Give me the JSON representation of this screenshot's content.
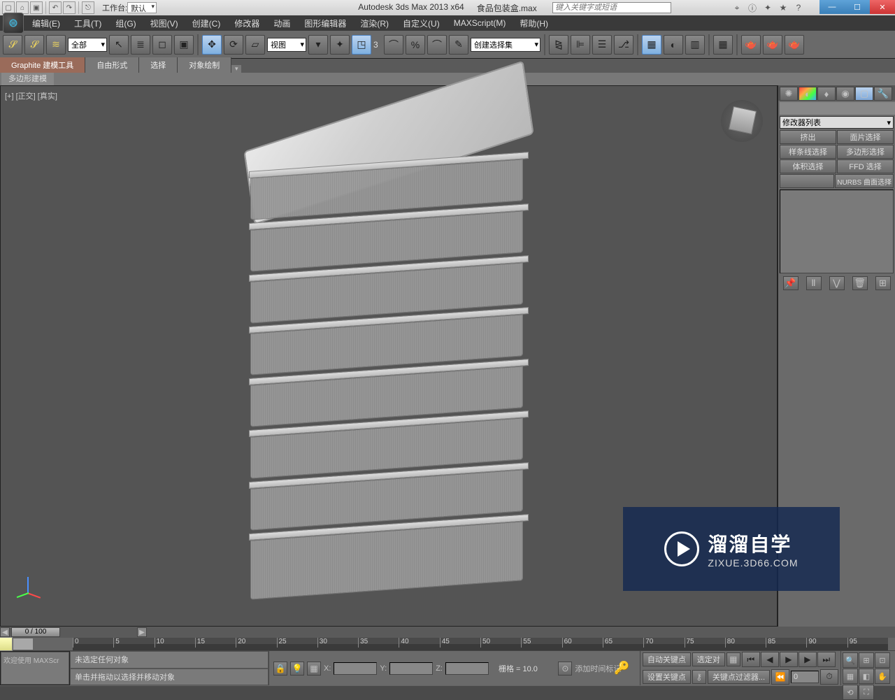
{
  "titlebar": {
    "workbench_label": "工作台:",
    "workbench_value": "默认",
    "app_name": "Autodesk 3ds Max  2013 x64",
    "file_name": "食品包装盒.max",
    "search_placeholder": "键入关键字或短语"
  },
  "menu": {
    "edit": "编辑(E)",
    "tools": "工具(T)",
    "group": "组(G)",
    "views": "视图(V)",
    "create": "创建(C)",
    "modifiers": "修改器",
    "animation": "动画",
    "graph": "图形编辑器",
    "rendering": "渲染(R)",
    "customize": "自定义(U)",
    "maxscript": "MAXScript(M)",
    "help": "帮助(H)"
  },
  "toolbar": {
    "filter_all": "全部",
    "view_label": "视图",
    "selset_label": "创建选择集"
  },
  "ribbon": {
    "tab1": "Graphite 建模工具",
    "tab2": "自由形式",
    "tab3": "选择",
    "tab4": "对象绘制",
    "sub1": "多边形建模"
  },
  "viewport": {
    "label": "[+] [正交] [真实]"
  },
  "cmdpanel": {
    "modifier_list": "修改器列表",
    "btn_extrude": "挤出",
    "btn_face_select": "面片选择",
    "btn_spline_select": "样条线选择",
    "btn_poly_select": "多边形选择",
    "btn_vol_select": "体积选择",
    "btn_ffd_select": "FFD 选择",
    "btn_nurbs": "NURBS 曲面选择"
  },
  "timeline": {
    "slider": "0 / 100",
    "ticks": [
      "0",
      "5",
      "10",
      "15",
      "20",
      "25",
      "30",
      "35",
      "40",
      "45",
      "50",
      "55",
      "60",
      "65",
      "70",
      "75",
      "80",
      "85",
      "90",
      "95"
    ]
  },
  "status": {
    "welcome": "欢迎使用  MAXScr",
    "msg1": "未选定任何对象",
    "msg2": "单击并拖动以选择并移动对象",
    "x_label": "X:",
    "y_label": "Y:",
    "z_label": "Z:",
    "grid": "栅格 = 10.0",
    "autokey": "自动关键点",
    "selset": "选定对",
    "setkey": "设置关键点",
    "keyfilter": "关键点过滤器...",
    "addtime": "添加时间标记"
  },
  "watermark": {
    "line1": "溜溜自学",
    "line2": "ZIXUE.3D66.COM"
  }
}
